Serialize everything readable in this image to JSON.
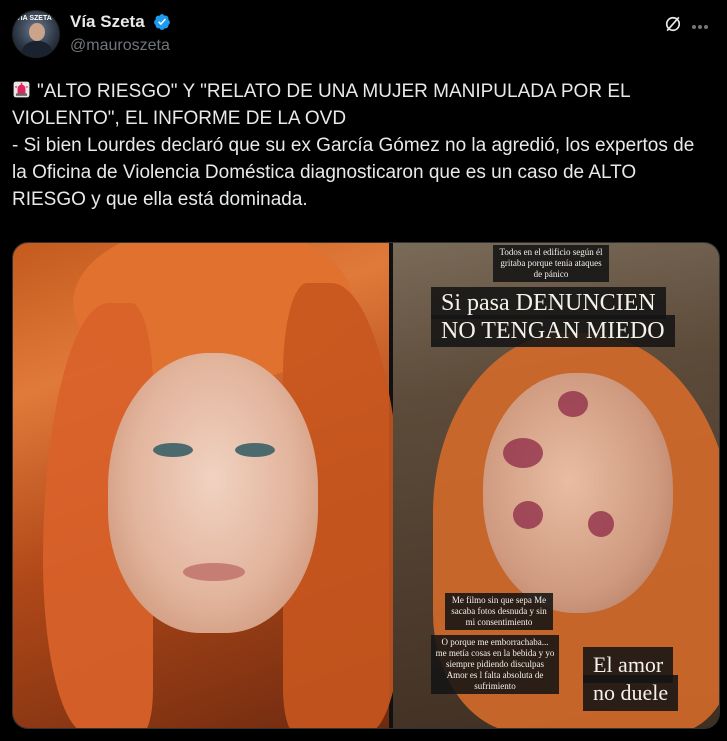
{
  "author": {
    "display_name": "Vía Szeta",
    "handle": "@mauroszeta",
    "avatar_logo": "VÍA SZETA",
    "verified_color": "#1d9bf0"
  },
  "tweet": {
    "line1": "\"ALTO RIESGO\" Y \"RELATO DE UNA MUJER MANIPULADA POR EL VIOLENTO\", EL INFORME DE LA OVD",
    "line2": "- Si bien Lourdes declaró que su ex García Gómez no la agredió, los expertos de la Oficina de Violencia Doméstica diagnosticaron que es un caso de ALTO RIESGO y que ella está dominada.",
    "leading_icon": "siren-icon"
  },
  "media": {
    "right_image": {
      "caption_top_small": "Todos en el edificio según él gritaba porque tenía ataques de pánico",
      "caption_main_1": "Si pasa DENUNCIEN",
      "caption_main_2": "NO TENGAN MIEDO",
      "caption_mid_small": "Me filmo sin que sepa Me sacaba fotos desnuda y sin mi consentimiento",
      "caption_low_small": "O porque me emborrachaba... me metía cosas en la bebida y yo siempre pidiendo disculpas Amor es l falta absoluta de sufrimiento",
      "caption_bottom_1": "El amor",
      "caption_bottom_2": "no duele"
    }
  },
  "icons": [
    "grok-icon",
    "more-icon",
    "verified-icon",
    "siren-icon"
  ]
}
